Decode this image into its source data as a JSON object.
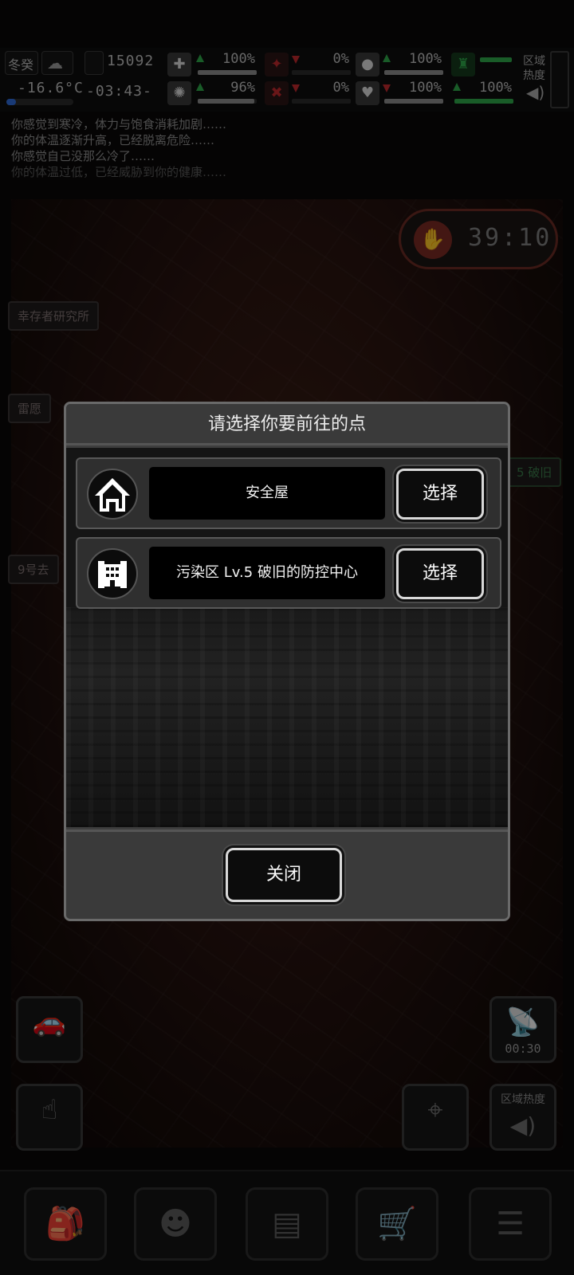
{
  "hud": {
    "season": "冬癸",
    "temperature": "-16.6°C",
    "day_counter": "15092",
    "clock": "-03:43-",
    "stats": [
      {
        "name": "health",
        "value": "100%",
        "level": 1.0
      },
      {
        "name": "bleeding",
        "value": "0%",
        "level": 0.0
      },
      {
        "name": "stomach",
        "value": "100%",
        "level": 1.0
      },
      {
        "name": "stamina",
        "value": "100%",
        "level": 1.0
      },
      {
        "name": "mind",
        "value": "96%",
        "level": 0.96
      },
      {
        "name": "infection",
        "value": "0%",
        "level": 0.0
      },
      {
        "name": "heart",
        "value": "100%",
        "level": 1.0
      },
      {
        "name": "energy",
        "value": "100%",
        "level": 1.0
      }
    ],
    "region_heat_label": "区域热度"
  },
  "log": [
    "你感觉到寒冷，体力与饱食消耗加剧……",
    "你的体温逐渐升高，已经脱离危险……",
    "你感觉自己没那么冷了……",
    "你的体温过低，已经威胁到你的健康……"
  ],
  "map": {
    "countdown": "39:10",
    "location_tag": "幸存者研究所",
    "side_tag_1": "雷愿",
    "side_tag_2": "9号去",
    "right_tag": "5 破旧"
  },
  "side_buttons": {
    "radio_timer": "00:30",
    "region_heat_label": "区域热度"
  },
  "dialog": {
    "title": "请选择你要前往的点",
    "destinations": [
      {
        "name": "安全屋",
        "icon": "house-icon",
        "select_label": "选择"
      },
      {
        "name": "污染区 Lv.5 破旧的防控中心",
        "icon": "building-icon",
        "select_label": "选择"
      }
    ],
    "close_label": "关闭"
  }
}
